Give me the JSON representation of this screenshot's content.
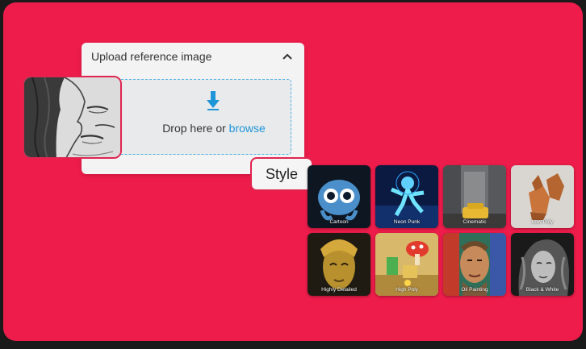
{
  "upload": {
    "title": "Upload reference image",
    "drop_text": "Drop here or",
    "browse_label": "browse"
  },
  "style_chip": {
    "label": "Style"
  },
  "styles": [
    {
      "label": "Cartoon"
    },
    {
      "label": "Neon Punk"
    },
    {
      "label": "Cinematic"
    },
    {
      "label": "Low Poly"
    },
    {
      "label": "Highly Detailed"
    },
    {
      "label": "High Poly"
    },
    {
      "label": "Oil Painting"
    },
    {
      "label": "Black & White"
    }
  ],
  "colors": {
    "background": "#ee1c4a",
    "accent_link": "#1d95d8",
    "dropzone_border": "#4db3e6"
  }
}
